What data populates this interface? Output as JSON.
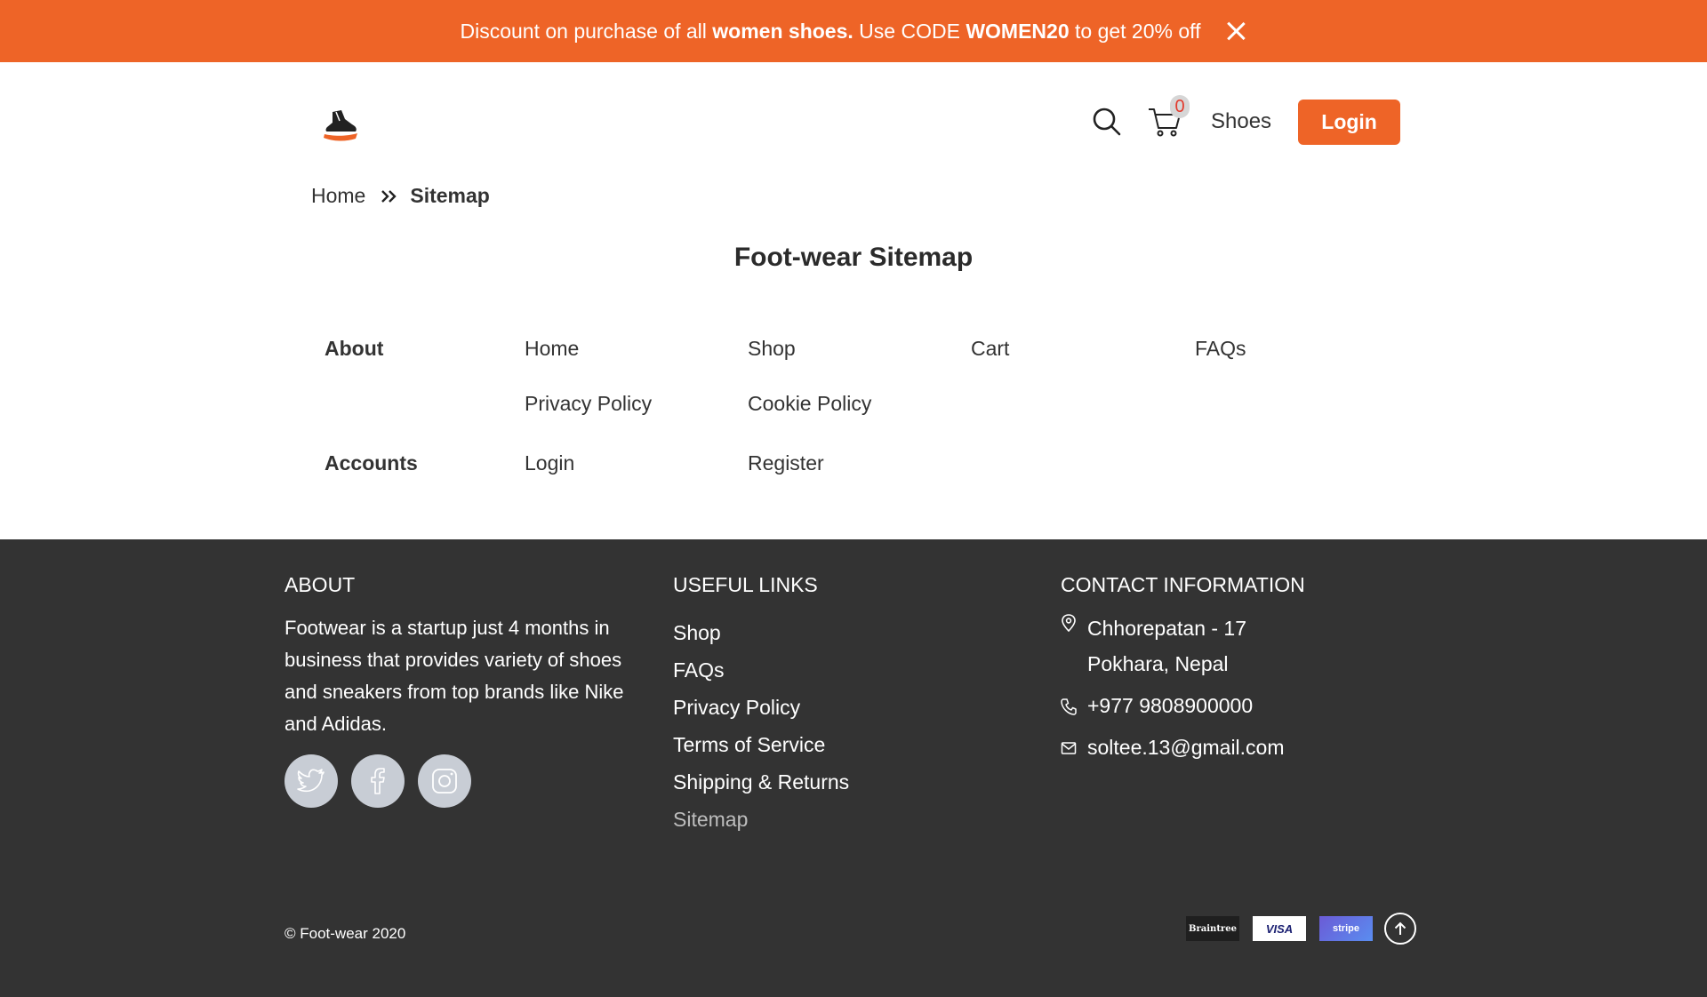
{
  "announcement": {
    "text_1": "Discount on purchase of all ",
    "bold_1": "women shoes.",
    "text_2": " Use CODE ",
    "bold_2": "WOMEN20",
    "text_3": " to get 20% off"
  },
  "header": {
    "cart_count": "0",
    "shoes_label": "Shoes",
    "login_label": "Login"
  },
  "breadcrumb": {
    "home": "Home",
    "current": "Sitemap"
  },
  "page_title": "Foot-wear Sitemap",
  "sitemap": {
    "about_heading": "About",
    "about_links": [
      "Home",
      "Shop",
      "Cart",
      "FAQs",
      "Privacy Policy",
      "Cookie Policy"
    ],
    "accounts_heading": "Accounts",
    "accounts_links": [
      "Login",
      "Register"
    ]
  },
  "footer": {
    "about_title": "ABOUT",
    "about_text": "Footwear is a startup just 4 months in business that provides variety of shoes and sneakers from top brands like Nike and Adidas.",
    "links_title": "USEFUL LINKS",
    "links": [
      "Shop",
      "FAQs",
      "Privacy Policy",
      "Terms of Service",
      "Shipping & Returns",
      "Sitemap"
    ],
    "contact_title": "CONTACT INFORMATION",
    "address_line1": "Chhorepatan - 17",
    "address_line2": "Pokhara, Nepal",
    "phone": "+977 9808900000",
    "email": "soltee.13@gmail.com",
    "copyright": "© Foot-wear 2020",
    "payments": [
      "Braintree",
      "VISA",
      "stripe"
    ]
  },
  "colors": {
    "accent": "#ee6427",
    "footer_bg": "#333333"
  }
}
